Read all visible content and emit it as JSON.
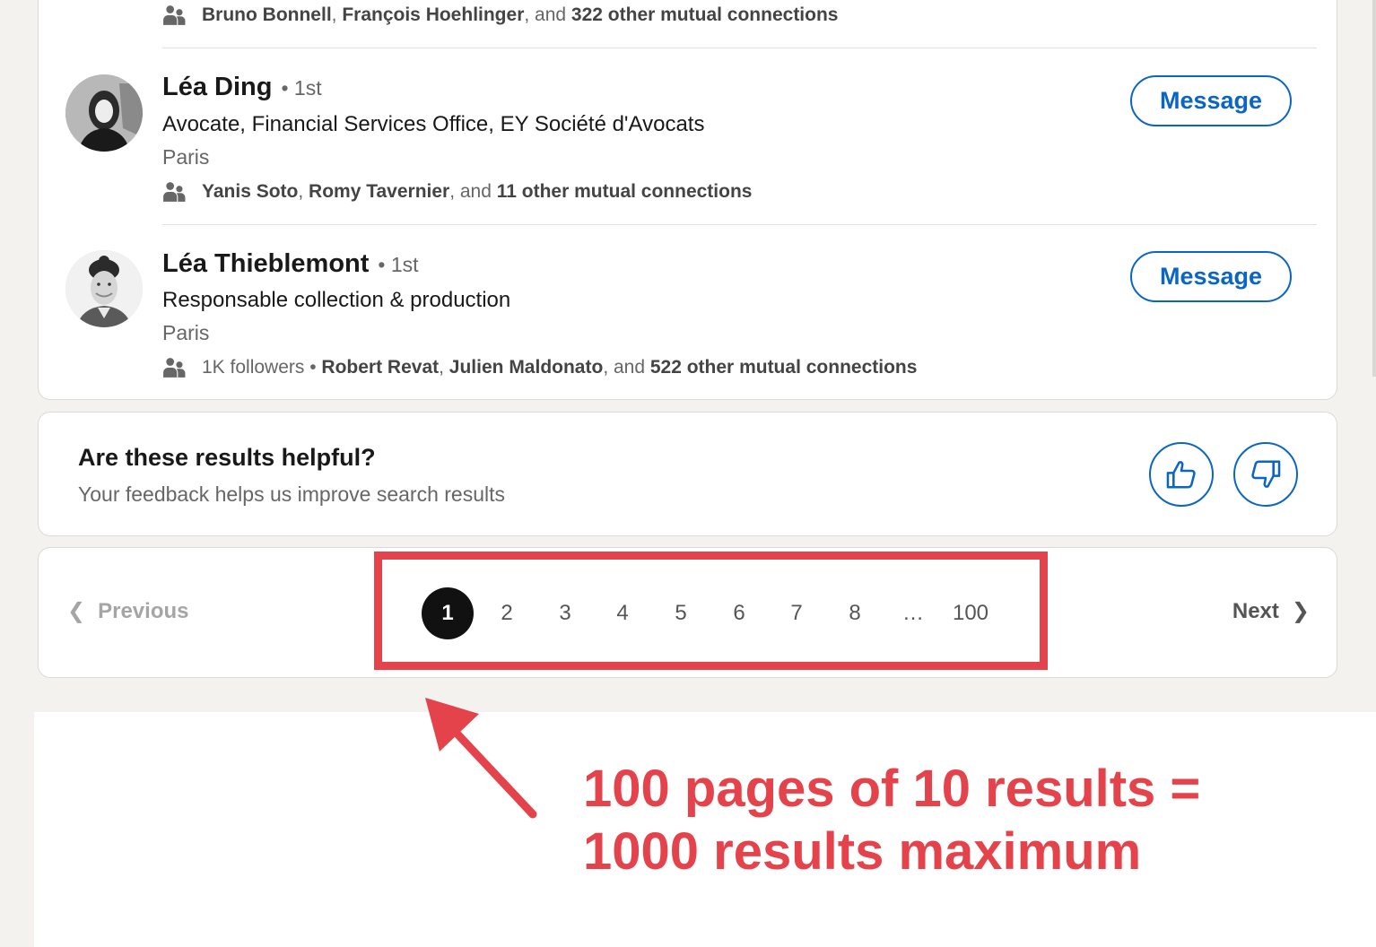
{
  "results": {
    "top_mutual": {
      "names": [
        "Bruno Bonnell",
        "François Hoehlinger"
      ],
      "sep": ", ",
      "and": ", and ",
      "count_text": "322 other mutual connections"
    },
    "people": [
      {
        "name": "Léa Ding",
        "degree": "• 1st",
        "headline": "Avocate, Financial Services Office, EY Société d'Avocats",
        "location": "Paris",
        "followers": "",
        "mutual_names": [
          "Yanis Soto",
          "Romy Tavernier"
        ],
        "mutual_count": "11 other mutual connections",
        "button": "Message"
      },
      {
        "name": "Léa Thieblemont",
        "degree": "• 1st",
        "headline": "Responsable collection & production",
        "location": "Paris",
        "followers": "1K followers",
        "mutual_names": [
          "Robert Revat",
          "Julien Maldonato"
        ],
        "mutual_count": "522 other mutual connections",
        "button": "Message"
      }
    ],
    "sep": ", ",
    "and": ", and ",
    "bullet": " • "
  },
  "feedback": {
    "title": "Are these results helpful?",
    "subtitle": "Your feedback helps us improve search results",
    "icons": [
      "thumbs-up-icon",
      "thumbs-down-icon"
    ]
  },
  "pagination": {
    "previous": "Previous",
    "next": "Next",
    "chev_left": "❮",
    "chev_right": "❯",
    "pages": [
      "1",
      "2",
      "3",
      "4",
      "5",
      "6",
      "7",
      "8",
      "…",
      "100"
    ],
    "current": "1"
  },
  "annotation": {
    "line1": "100 pages of 10 results =",
    "line2": "1000 results maximum",
    "color": "#e5434b"
  },
  "colors": {
    "accent": "#0a66c2",
    "background": "#f4f2ee"
  }
}
